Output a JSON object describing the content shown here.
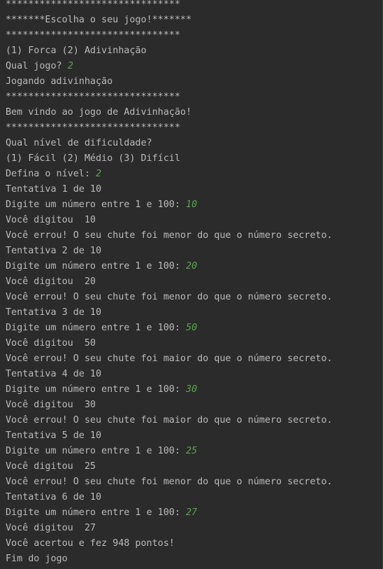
{
  "theme": {
    "background": "#2b2b2b",
    "text": "#bbbbbb",
    "user_input": "#57a64a"
  },
  "console": {
    "lines": [
      {
        "text": "*******************************"
      },
      {
        "text": "*******Escolha o seu jogo!*******"
      },
      {
        "text": "*******************************"
      },
      {
        "text": "(1) Forca (2) Adivinhação"
      },
      {
        "text": "Qual jogo? ",
        "input": "2"
      },
      {
        "text": "Jogando adivinhação"
      },
      {
        "text": "*******************************"
      },
      {
        "text": "Bem vindo ao jogo de Adivinhação!"
      },
      {
        "text": "*******************************"
      },
      {
        "text": "Qual nível de dificuldade?"
      },
      {
        "text": "(1) Fácil (2) Médio (3) Difícil"
      },
      {
        "text": "Defina o nível: ",
        "input": "2"
      },
      {
        "text": "Tentativa 1 de 10"
      },
      {
        "text": "Digite um número entre 1 e 100: ",
        "input": "10"
      },
      {
        "text": "Você digitou  10"
      },
      {
        "text": "Você errou! O seu chute foi menor do que o número secreto."
      },
      {
        "text": "Tentativa 2 de 10"
      },
      {
        "text": "Digite um número entre 1 e 100: ",
        "input": "20"
      },
      {
        "text": "Você digitou  20"
      },
      {
        "text": "Você errou! O seu chute foi menor do que o número secreto."
      },
      {
        "text": "Tentativa 3 de 10"
      },
      {
        "text": "Digite um número entre 1 e 100: ",
        "input": "50"
      },
      {
        "text": "Você digitou  50"
      },
      {
        "text": "Você errou! O seu chute foi maior do que o número secreto."
      },
      {
        "text": "Tentativa 4 de 10"
      },
      {
        "text": "Digite um número entre 1 e 100: ",
        "input": "30"
      },
      {
        "text": "Você digitou  30"
      },
      {
        "text": "Você errou! O seu chute foi maior do que o número secreto."
      },
      {
        "text": "Tentativa 5 de 10"
      },
      {
        "text": "Digite um número entre 1 e 100: ",
        "input": "25"
      },
      {
        "text": "Você digitou  25"
      },
      {
        "text": "Você errou! O seu chute foi menor do que o número secreto."
      },
      {
        "text": "Tentativa 6 de 10"
      },
      {
        "text": "Digite um número entre 1 e 100: ",
        "input": "27"
      },
      {
        "text": "Você digitou  27"
      },
      {
        "text": "Você acertou e fez 948 pontos!"
      },
      {
        "text": "Fim do jogo"
      }
    ]
  }
}
